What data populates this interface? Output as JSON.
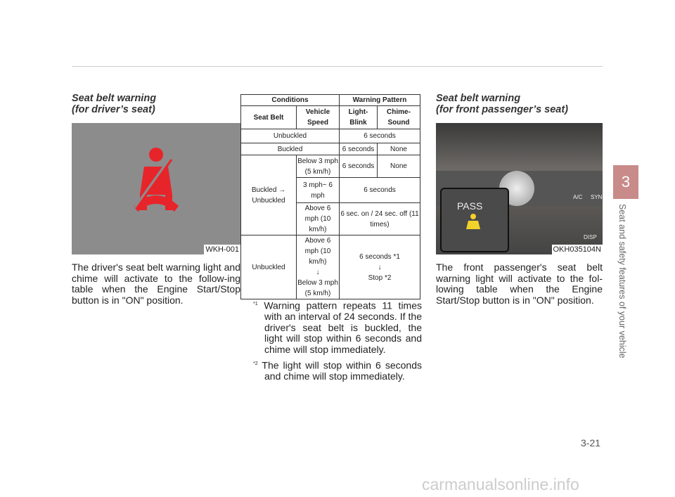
{
  "left": {
    "title_line1": "Seat belt warning",
    "title_line2": "(for driver’s seat)",
    "image_caption": "WKH-001",
    "body": "The driver's seat belt warning light and chime will activate to the follow-ing table when the Engine Start/Stop button is in \"ON\" position."
  },
  "table": {
    "header": {
      "conditions": "Conditions",
      "warning_pattern": "Warning Pattern",
      "seat_belt": "Seat Belt",
      "vehicle_speed": "Vehicle Speed",
      "light_blink": "Light-Blink",
      "chime_sound": "Chime-Sound"
    },
    "rows": [
      {
        "condition": "Unbuckled",
        "pattern": "6 seconds"
      },
      {
        "condition": "Buckled",
        "light": "6 seconds",
        "chime": "None"
      },
      {
        "condition": "Buckled → Unbuckled",
        "speed": "Below 3 mph (5 km/h)",
        "light": "6 seconds",
        "chime": "None"
      },
      {
        "speed": "3 mph~ 6 mph",
        "pattern": "6 seconds"
      },
      {
        "speed": "Above 6 mph (10 km/h)",
        "pattern": "6 sec. on / 24 sec. off (11 times)"
      },
      {
        "condition": "Unbuckled",
        "speed_from": "Above 6 mph (10 km/h)",
        "arrow": "↓",
        "speed_to": "Below 3 mph (5 km/h)",
        "pattern_from": "6 seconds *1",
        "pattern_to": "Stop *2"
      }
    ]
  },
  "notes": [
    {
      "mark": "*1",
      "text": "Warning pattern repeats 11 times with an interval of 24 seconds. If the driver's seat belt is buckled, the light will stop within 6 seconds and chime will stop immediately."
    },
    {
      "mark": "*2",
      "text": "The light will stop within 6 seconds and chime will stop immediately."
    }
  ],
  "right": {
    "title_line1": "Seat belt warning",
    "title_line2": "(for front passenger’s seat)",
    "image_caption": "OKH035104N",
    "image_label": "PASS",
    "image_buttons": [
      "A/C",
      "SYNC",
      "DISP"
    ],
    "body": "The front passenger's seat belt warning light will activate to the fol-lowing table when the Engine Start/Stop button is in \"ON\" position."
  },
  "sidebar": {
    "chapter": "3",
    "section": "Seat and safety features of your vehicle"
  },
  "page_number": "3-21",
  "watermark": "carmanualsonline.info",
  "colors": {
    "tab": "#c98a8a",
    "seatbelt_icon": "#e8242b",
    "pass_icon": "#f2d22a"
  }
}
